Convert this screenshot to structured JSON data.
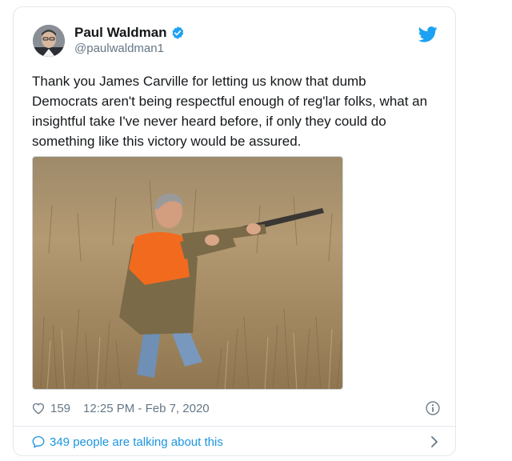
{
  "author": {
    "name": "Paul Waldman",
    "handle": "@paulwaldman1"
  },
  "tweet": {
    "text": "Thank you James Carville for letting us know that dumb Democrats aren't being respectful enough of reg'lar folks, what an insightful take I've never heard before, if only they could do something like this victory would be assured."
  },
  "stats": {
    "likes": "159",
    "timestamp": "12:25 PM - Feb 7, 2020"
  },
  "conversation": {
    "label": "349 people are talking about this"
  },
  "icons": {
    "verified": "verified-badge-icon",
    "bird": "twitter-bird-icon",
    "heart": "heart-icon",
    "info": "info-icon",
    "bubble": "speech-bubble-icon",
    "chevron": "chevron-right-icon"
  },
  "colors": {
    "brand": "#1da1f2",
    "link": "#1b95e0",
    "secondary_text": "#657786",
    "border": "#e1e8ed"
  }
}
